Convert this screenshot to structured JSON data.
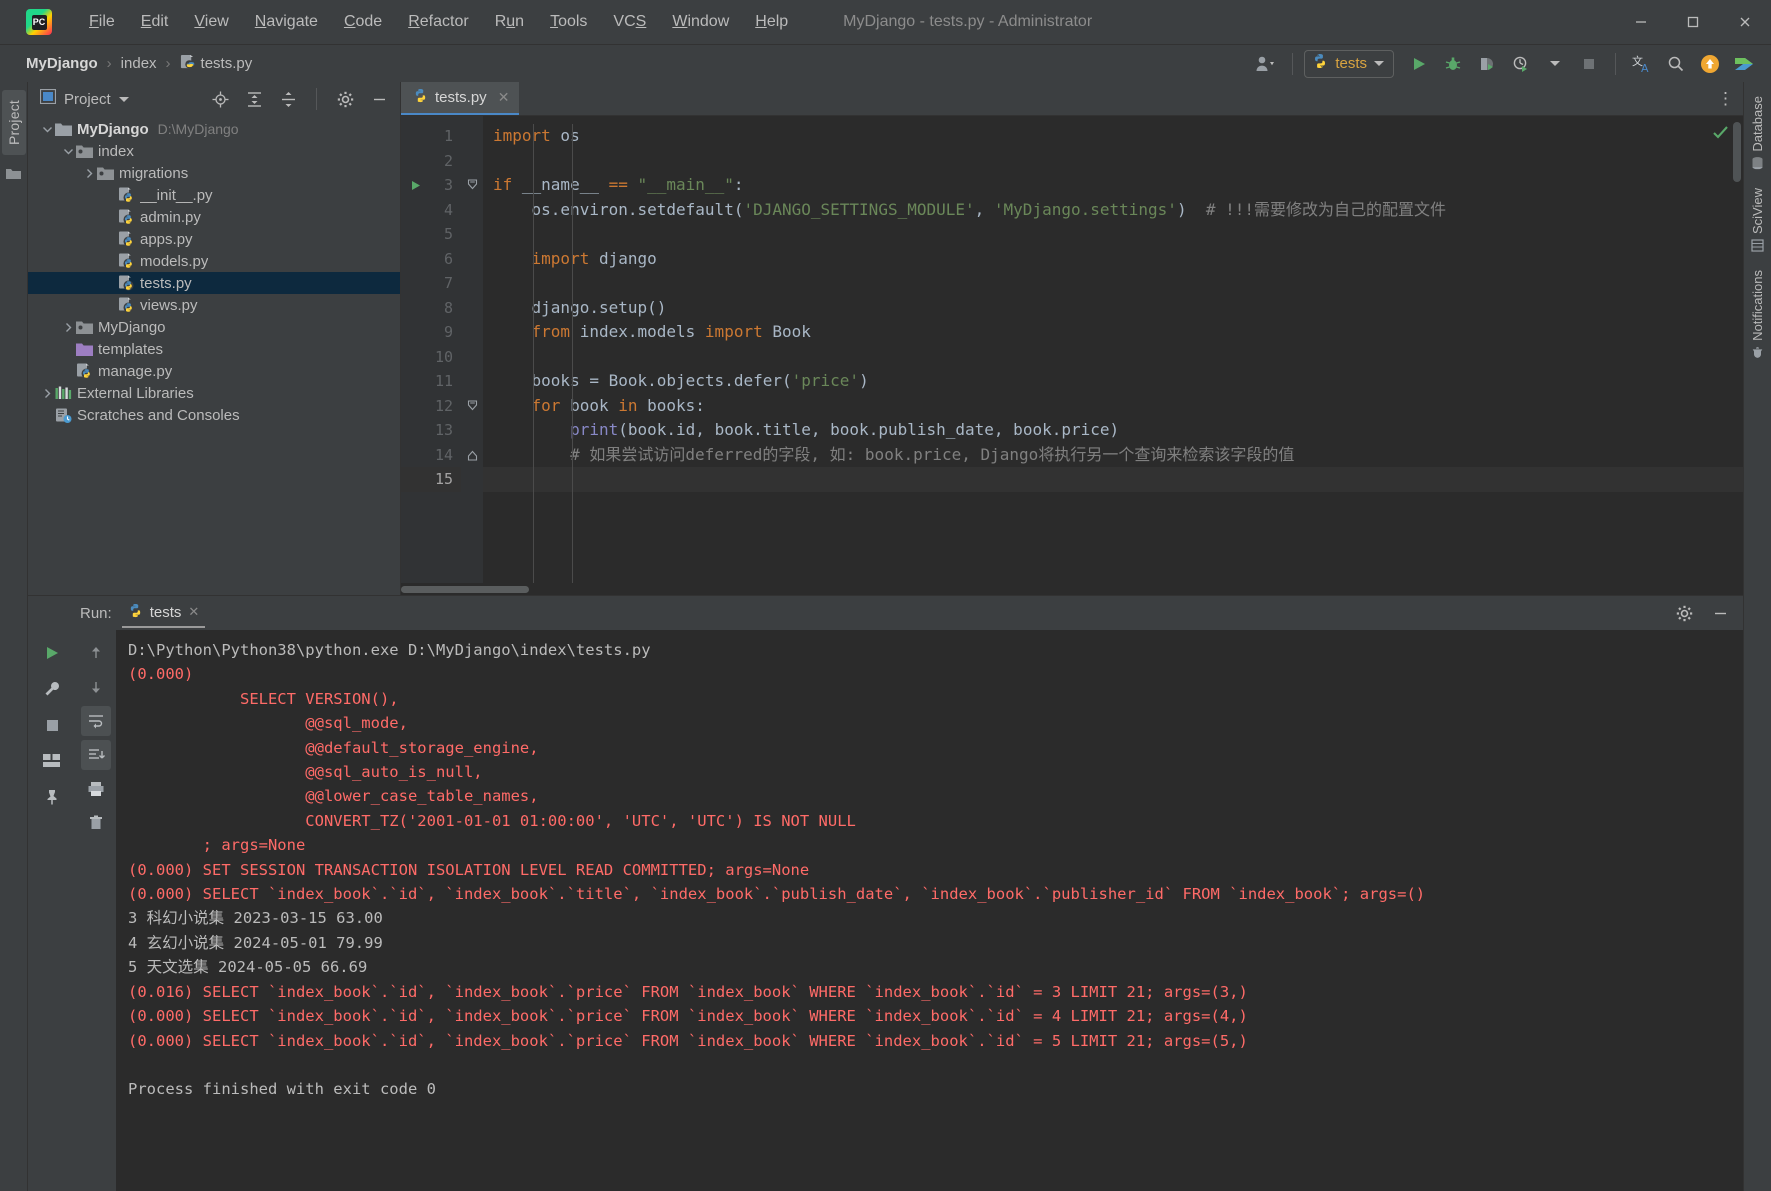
{
  "window": {
    "title": "MyDjango - tests.py - Administrator",
    "minimize": "minimize-icon",
    "maximize": "maximize-icon",
    "close": "close-icon"
  },
  "menu": {
    "items": [
      "File",
      "Edit",
      "View",
      "Navigate",
      "Code",
      "Refactor",
      "Run",
      "Tools",
      "VCS",
      "Window",
      "Help"
    ]
  },
  "breadcrumb": {
    "project": "MyDjango",
    "package": "index",
    "file": "tests.py"
  },
  "toolbar": {
    "run_config": "tests",
    "run_label": "Run",
    "debug_label": "Debug",
    "coverage_label": "Run with Coverage",
    "profile_label": "Profile",
    "stop_label": "Stop",
    "translate_label": "Translate",
    "search_label": "Search Everywhere",
    "update_label": "Update",
    "share_label": "Share"
  },
  "project_tool": {
    "title": "Project",
    "rail_tab": "Project",
    "tree": [
      {
        "label": "MyDjango",
        "path": "D:\\MyDjango",
        "depth": 0,
        "icon": "folder-root-icon",
        "twist": "expanded",
        "bold": true,
        "selected": false
      },
      {
        "label": "index",
        "path": "",
        "depth": 1,
        "icon": "module-folder-icon",
        "twist": "expanded",
        "bold": false,
        "selected": false
      },
      {
        "label": "migrations",
        "path": "",
        "depth": 2,
        "icon": "module-folder-icon",
        "twist": "collapsed",
        "bold": false,
        "selected": false
      },
      {
        "label": "__init__.py",
        "path": "",
        "depth": 3,
        "icon": "python-file-icon",
        "twist": "none",
        "bold": false,
        "selected": false
      },
      {
        "label": "admin.py",
        "path": "",
        "depth": 3,
        "icon": "python-file-icon",
        "twist": "none",
        "bold": false,
        "selected": false
      },
      {
        "label": "apps.py",
        "path": "",
        "depth": 3,
        "icon": "python-file-icon",
        "twist": "none",
        "bold": false,
        "selected": false
      },
      {
        "label": "models.py",
        "path": "",
        "depth": 3,
        "icon": "python-file-icon",
        "twist": "none",
        "bold": false,
        "selected": false
      },
      {
        "label": "tests.py",
        "path": "",
        "depth": 3,
        "icon": "python-file-icon",
        "twist": "none",
        "bold": false,
        "selected": true
      },
      {
        "label": "views.py",
        "path": "",
        "depth": 3,
        "icon": "python-file-icon",
        "twist": "none",
        "bold": false,
        "selected": false
      },
      {
        "label": "MyDjango",
        "path": "",
        "depth": 1,
        "icon": "module-folder-icon",
        "twist": "collapsed",
        "bold": false,
        "selected": false
      },
      {
        "label": "templates",
        "path": "",
        "depth": 1,
        "icon": "templates-folder-icon",
        "twist": "none",
        "bold": false,
        "selected": false
      },
      {
        "label": "manage.py",
        "path": "",
        "depth": 1,
        "icon": "python-file-icon",
        "twist": "none",
        "bold": false,
        "selected": false
      },
      {
        "label": "External Libraries",
        "path": "",
        "depth": 0,
        "icon": "libraries-icon",
        "twist": "collapsed",
        "bold": false,
        "selected": false
      },
      {
        "label": "Scratches and Consoles",
        "path": "",
        "depth": 0,
        "icon": "scratches-icon",
        "twist": "none",
        "bold": false,
        "selected": false
      }
    ]
  },
  "editor": {
    "tab": "tests.py",
    "tab_icon": "python-file-icon",
    "close_icon": "close-icon",
    "inspection_status": "ok-check-icon",
    "lines": [
      {
        "n": 1,
        "tokens": [
          {
            "t": "kw",
            "v": "import"
          },
          {
            "t": "def",
            "v": " os"
          }
        ]
      },
      {
        "n": 2,
        "tokens": []
      },
      {
        "n": 3,
        "tokens": [
          {
            "t": "kw",
            "v": "if"
          },
          {
            "t": "def",
            "v": " __name__ "
          },
          {
            "t": "kw",
            "v": "=="
          },
          {
            "t": "def",
            "v": " "
          },
          {
            "t": "str",
            "v": "\"__main__\""
          },
          {
            "t": "def",
            "v": ":"
          }
        ],
        "gutter_mark": "run-arrow-icon",
        "fold": "fold-start"
      },
      {
        "n": 4,
        "tokens": [
          {
            "t": "def",
            "v": "    os.environ.setdefault("
          },
          {
            "t": "str",
            "v": "'DJANGO_SETTINGS_MODULE'"
          },
          {
            "t": "def",
            "v": ", "
          },
          {
            "t": "str",
            "v": "'MyDjango.settings'"
          },
          {
            "t": "def",
            "v": ")  "
          },
          {
            "t": "com",
            "v": "# !!!需要修改为自己的配置文件"
          }
        ]
      },
      {
        "n": 5,
        "tokens": []
      },
      {
        "n": 6,
        "tokens": [
          {
            "t": "def",
            "v": "    "
          },
          {
            "t": "kw",
            "v": "import"
          },
          {
            "t": "def",
            "v": " django"
          }
        ]
      },
      {
        "n": 7,
        "tokens": []
      },
      {
        "n": 8,
        "tokens": [
          {
            "t": "def",
            "v": "    django.setup()"
          }
        ]
      },
      {
        "n": 9,
        "tokens": [
          {
            "t": "def",
            "v": "    "
          },
          {
            "t": "kw",
            "v": "from"
          },
          {
            "t": "def",
            "v": " index.models "
          },
          {
            "t": "kw",
            "v": "import"
          },
          {
            "t": "def",
            "v": " Book"
          }
        ]
      },
      {
        "n": 10,
        "tokens": []
      },
      {
        "n": 11,
        "tokens": [
          {
            "t": "def",
            "v": "    books = Book.objects.defer("
          },
          {
            "t": "str",
            "v": "'price'"
          },
          {
            "t": "def",
            "v": ")"
          }
        ]
      },
      {
        "n": 12,
        "tokens": [
          {
            "t": "def",
            "v": "    "
          },
          {
            "t": "kw",
            "v": "for"
          },
          {
            "t": "def",
            "v": " book "
          },
          {
            "t": "kw",
            "v": "in"
          },
          {
            "t": "def",
            "v": " books:"
          }
        ],
        "fold": "fold-start"
      },
      {
        "n": 13,
        "tokens": [
          {
            "t": "def",
            "v": "        "
          },
          {
            "t": "fn",
            "v": "print"
          },
          {
            "t": "def",
            "v": "(book.id, book.title, book.publish_date, book.price)"
          }
        ]
      },
      {
        "n": 14,
        "tokens": [
          {
            "t": "def",
            "v": "        "
          },
          {
            "t": "com",
            "v": "# 如果尝试访问deferred的字段, 如: book.price, Django将执行另一个查询来检索该字段的值"
          }
        ],
        "fold": "fold-end"
      },
      {
        "n": 15,
        "tokens": [],
        "current": true
      }
    ]
  },
  "run_tool": {
    "label": "Run:",
    "tab": "tests",
    "tab_icon": "python-file-icon",
    "close_icon": "close-icon",
    "settings_icon": "gear-icon",
    "hide_icon": "minimize-icon",
    "buttons": [
      "rerun-icon",
      "up-arrow-icon",
      "wrench-icon",
      "down-arrow-icon",
      "stop-icon",
      "soft-wrap-icon",
      "layout-icon",
      "scroll-to-end-icon",
      "print-icon",
      "pin-icon",
      "trash-icon"
    ],
    "output": [
      {
        "kind": "out",
        "text": "D:\\Python\\Python38\\python.exe D:\\MyDjango\\index\\tests.py"
      },
      {
        "kind": "err",
        "text": "(0.000)"
      },
      {
        "kind": "err",
        "text": "            SELECT VERSION(),"
      },
      {
        "kind": "err",
        "text": "                   @@sql_mode,"
      },
      {
        "kind": "err",
        "text": "                   @@default_storage_engine,"
      },
      {
        "kind": "err",
        "text": "                   @@sql_auto_is_null,"
      },
      {
        "kind": "err",
        "text": "                   @@lower_case_table_names,"
      },
      {
        "kind": "err",
        "text": "                   CONVERT_TZ('2001-01-01 01:00:00', 'UTC', 'UTC') IS NOT NULL"
      },
      {
        "kind": "err",
        "text": "        ; args=None"
      },
      {
        "kind": "err",
        "text": "(0.000) SET SESSION TRANSACTION ISOLATION LEVEL READ COMMITTED; args=None"
      },
      {
        "kind": "err",
        "text": "(0.000) SELECT `index_book`.`id`, `index_book`.`title`, `index_book`.`publish_date`, `index_book`.`publisher_id` FROM `index_book`; args=()"
      },
      {
        "kind": "out",
        "text": "3 科幻小说集 2023-03-15 63.00"
      },
      {
        "kind": "out",
        "text": "4 玄幻小说集 2024-05-01 79.99"
      },
      {
        "kind": "out",
        "text": "5 天文选集 2024-05-05 66.69"
      },
      {
        "kind": "err",
        "text": "(0.016) SELECT `index_book`.`id`, `index_book`.`price` FROM `index_book` WHERE `index_book`.`id` = 3 LIMIT 21; args=(3,)"
      },
      {
        "kind": "err",
        "text": "(0.000) SELECT `index_book`.`id`, `index_book`.`price` FROM `index_book` WHERE `index_book`.`id` = 4 LIMIT 21; args=(4,)"
      },
      {
        "kind": "err",
        "text": "(0.000) SELECT `index_book`.`id`, `index_book`.`price` FROM `index_book` WHERE `index_book`.`id` = 5 LIMIT 21; args=(5,)"
      },
      {
        "kind": "out",
        "text": ""
      },
      {
        "kind": "out",
        "text": "Process finished with exit code 0"
      }
    ]
  },
  "right_rail": {
    "tabs": [
      "Database",
      "SciView",
      "Notifications"
    ]
  },
  "colors": {
    "accent": "#4a88c7",
    "selection": "#0d293e",
    "error_text": "#ff6b68",
    "keyword": "#cc7832",
    "string": "#6a8759",
    "comment": "#808080",
    "function": "#8888c6",
    "run_config_text": "#d9a441",
    "green_run": "#59a869"
  }
}
